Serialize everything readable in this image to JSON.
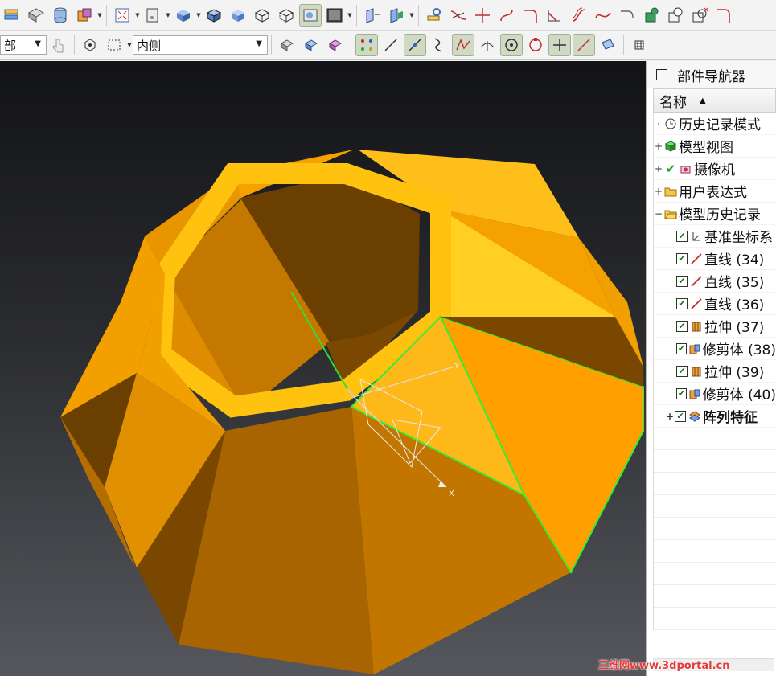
{
  "toolbar2": {
    "filter_value": "部",
    "location_value": "内侧"
  },
  "viewport": {
    "axis_x_label": "X",
    "axis_y_label": "Y"
  },
  "navigator": {
    "title": "部件导航器",
    "column_header": "名称",
    "items": [
      {
        "label": "历史记录模式"
      },
      {
        "label": "模型视图"
      },
      {
        "label": "摄像机"
      },
      {
        "label": "用户表达式"
      },
      {
        "label": "模型历史记录"
      },
      {
        "label": "基准坐标系"
      },
      {
        "label": "直线 (34)"
      },
      {
        "label": "直线 (35)"
      },
      {
        "label": "直线 (36)"
      },
      {
        "label": "拉伸 (37)"
      },
      {
        "label": "修剪体 (38)"
      },
      {
        "label": "拉伸 (39)"
      },
      {
        "label": "修剪体 (40)"
      },
      {
        "label": "阵列特征"
      }
    ]
  },
  "watermark": "三维网www.3dportal.cn",
  "colors": {
    "model_face": "#f0a000",
    "highlight": "#33ee33",
    "viewport_top": "#121316",
    "viewport_bottom": "#55575c"
  }
}
